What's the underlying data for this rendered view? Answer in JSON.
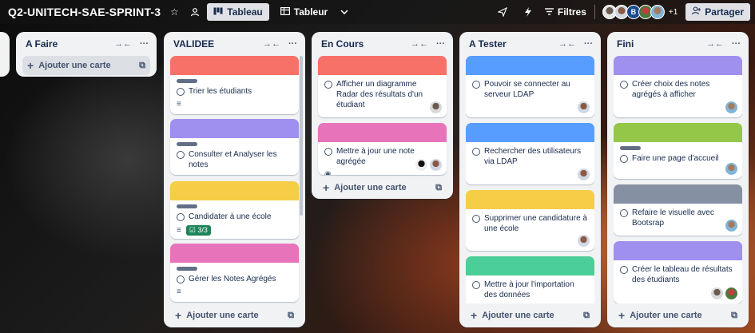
{
  "board": {
    "title": "Q2-UNITECH-SAE-SPRINT-3",
    "views": [
      {
        "label": "Tableau",
        "icon": "board-icon"
      },
      {
        "label": "Tableur",
        "icon": "table-icon"
      }
    ],
    "filters_label": "Filtres",
    "members_extra": "+1",
    "member_initial": "B",
    "share_label": "Partager"
  },
  "lists": {
    "a_faire": {
      "title": "A Faire",
      "add_label": "Ajouter une carte"
    },
    "validee": {
      "title": "VALIDEE",
      "cards": [
        {
          "title": "Trier les étudiants",
          "cover": "#f87168"
        },
        {
          "title": "Consulter et Analyser les notes",
          "cover": "#9f8fef"
        },
        {
          "title": "Candidater à une école",
          "cover": "#f5cd47",
          "checklist": "3/3"
        },
        {
          "title": "Gérer les Notes Agrégés",
          "cover": "#e774bb"
        }
      ],
      "add_label": "Ajouter une carte"
    },
    "en_cours": {
      "title": "En Cours",
      "cards": [
        {
          "title": "Afficher un diagramme Radar des résultats d'un étudiant",
          "cover": "#f87168"
        },
        {
          "title": "Mettre à jour une note agrégée",
          "cover": "#e774bb"
        }
      ],
      "add_label": "Ajouter une carte"
    },
    "a_tester": {
      "title": "A Tester",
      "cards": [
        {
          "title": "Pouvoir se connecter au serveur LDAP",
          "cover": "#579dff"
        },
        {
          "title": "Rechercher des utilisateurs via LDAP",
          "cover": "#579dff"
        },
        {
          "title": "Supprimer une candidature à une école",
          "cover": "#f5cd47"
        },
        {
          "title": "Mettre à jour l'importation des données",
          "cover": "#4bce97"
        }
      ],
      "add_label": "Ajouter une carte"
    },
    "fini": {
      "title": "Fini",
      "cards": [
        {
          "title": "Créer choix des notes agrégés à afficher",
          "cover": "#9f8fef"
        },
        {
          "title": "Faire une page d'accueil",
          "cover": "#94c748"
        },
        {
          "title": "Refaire le visuelle avec Bootsrap",
          "cover": "#8590a2"
        },
        {
          "title": "Créer le tableau de résultats des étudiants",
          "cover": "#9f8fef"
        }
      ],
      "add_label": "Ajouter une carte"
    }
  }
}
